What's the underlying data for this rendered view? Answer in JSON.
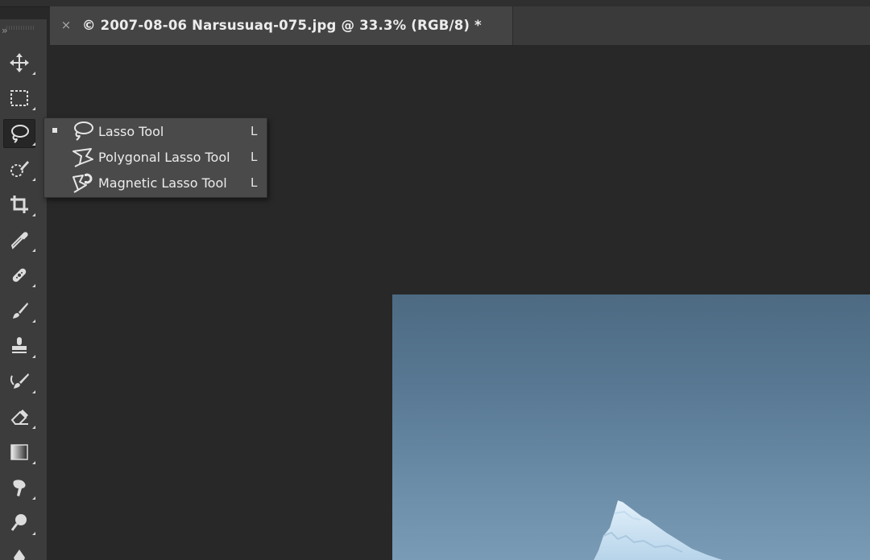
{
  "app": {
    "collapse_glyph": "››"
  },
  "document_tab": {
    "close_glyph": "×",
    "title": "© 2007-08-06 Narsusuaq-075.jpg @ 33.3% (RGB/8) *"
  },
  "toolbar": {
    "tools": [
      {
        "icon": "move-icon"
      },
      {
        "icon": "rectangular-marquee-icon"
      },
      {
        "icon": "lasso-icon",
        "active": true
      },
      {
        "icon": "quick-selection-icon"
      },
      {
        "icon": "crop-icon"
      },
      {
        "icon": "eyedropper-icon"
      },
      {
        "icon": "healing-brush-icon"
      },
      {
        "icon": "brush-icon"
      },
      {
        "icon": "clone-stamp-icon"
      },
      {
        "icon": "history-brush-icon"
      },
      {
        "icon": "eraser-icon"
      },
      {
        "icon": "gradient-icon"
      },
      {
        "icon": "smudge-icon"
      },
      {
        "icon": "dodge-icon"
      },
      {
        "icon": "pen-icon"
      }
    ]
  },
  "lasso_flyout": {
    "items": [
      {
        "label": "Lasso Tool",
        "shortcut": "L",
        "selected": true,
        "icon": "lasso-icon"
      },
      {
        "label": "Polygonal Lasso Tool",
        "shortcut": "L",
        "selected": false,
        "icon": "polygonal-lasso-icon"
      },
      {
        "label": "Magnetic Lasso Tool",
        "shortcut": "L",
        "selected": false,
        "icon": "magnetic-lasso-icon"
      }
    ]
  },
  "colors": {
    "workspace_bg": "#282828",
    "toolbar_bg": "#3c3c3c",
    "flyout_bg": "#4a4a4a",
    "sky_top": "#4d6a82",
    "sky_bottom": "#7a9bb5",
    "ice": "#cfe4f4"
  }
}
